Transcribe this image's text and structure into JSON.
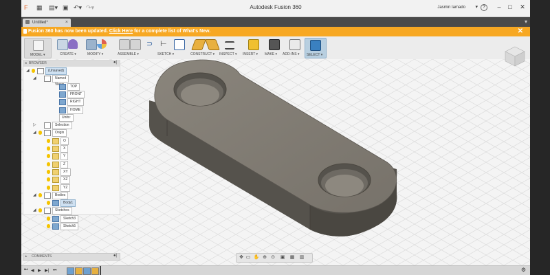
{
  "app": {
    "title": "Autodesk Fusion 360",
    "user": "Jasmin Iamado",
    "help": "?"
  },
  "tab": {
    "label": "Untitled*",
    "close": "×"
  },
  "notification": {
    "text_before": "Fusion 360 has now been updated.",
    "link": "Click Here",
    "text_after": "for a complete list of What's New.",
    "close": "✕"
  },
  "toolbar": {
    "model": "MODEL ▾",
    "create": "CREATE ▾",
    "modify": "MODIFY ▾",
    "assemble": "ASSEMBLE ▾",
    "sketch": "SKETCH ▾",
    "construct": "CONSTRUCT ▾",
    "inspect": "INSPECT ▾",
    "insert": "INSERT ▾",
    "make": "MAKE ▾",
    "addins": "ADD-INS ▾",
    "select": "SELECT ▾"
  },
  "browser": {
    "header": "BROWSER",
    "root": "(Unsaved)",
    "named_views": "Named Views",
    "views": [
      "TOP",
      "FRONT",
      "RIGHT",
      "HOME"
    ],
    "units": "Units: mm",
    "selection_sets": "Selection Sets",
    "origin": "Origin",
    "origin_items": [
      "O",
      "X",
      "Y",
      "Z",
      "XY",
      "XZ",
      "YZ"
    ],
    "bodies": "Bodies",
    "body1": "Body1",
    "sketches": "Sketches",
    "sketch_items": [
      "Sketch3",
      "Sketch5"
    ]
  },
  "comments": {
    "label": "COMMENTS"
  },
  "colors": {
    "notification": "#f7a823",
    "part": "#7a766f",
    "selection": "#cfe1f2"
  }
}
